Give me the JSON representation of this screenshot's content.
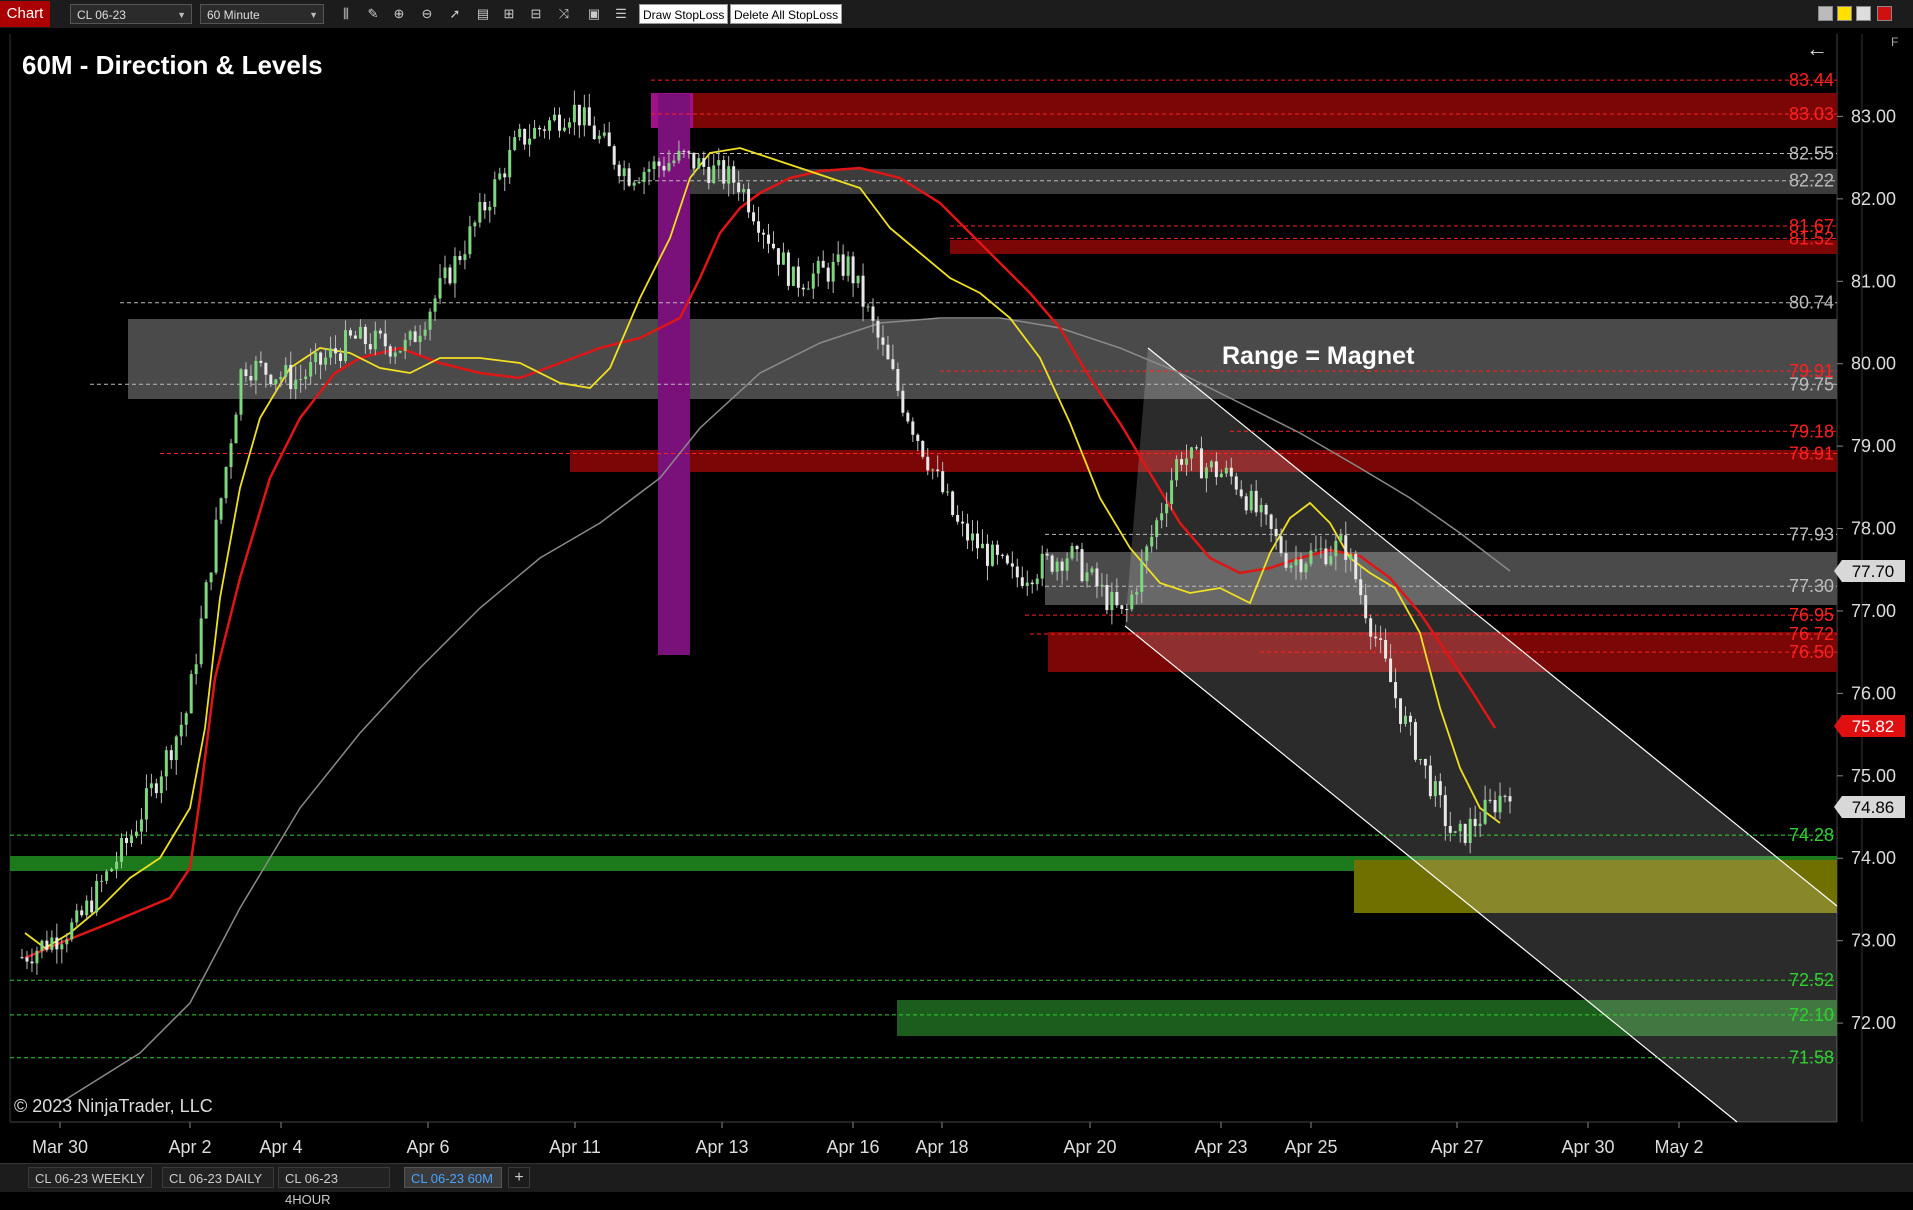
{
  "toolbar": {
    "chart_label": "Chart",
    "instrument": "CL 06-23",
    "interval": "60 Minute",
    "draw_stoploss": "Draw StopLoss",
    "delete_stoploss": "Delete All StopLoss"
  },
  "chart": {
    "title": "60M - Direction & Levels",
    "annotation": "Range = Magnet",
    "copyright": "© 2023 NinjaTrader, LLC",
    "back_arrow": "←",
    "panel_letter": "F",
    "y_axis": {
      "min": 70.8,
      "max": 84.0,
      "ticks": [
        "83.00",
        "82.00",
        "81.00",
        "80.00",
        "79.00",
        "78.00",
        "77.00",
        "76.00",
        "75.00",
        "74.00",
        "73.00",
        "72.00"
      ]
    },
    "x_axis": [
      "Mar 30",
      "Apr 2",
      "Apr 4",
      "Apr 6",
      "Apr 11",
      "Apr 13",
      "Apr 16",
      "Apr 18",
      "Apr 20",
      "Apr 23",
      "Apr 25",
      "Apr 27",
      "Apr 30",
      "May 2"
    ],
    "price_tags": [
      {
        "value": "77.70",
        "color": "#d8d8d8"
      },
      {
        "value": "75.82",
        "color": "#e01010"
      },
      {
        "value": "74.86",
        "color": "#d8d8d8"
      }
    ],
    "levels": [
      {
        "value": "83.44",
        "price": 83.44,
        "color": "#ff2020"
      },
      {
        "value": "83.03",
        "price": 83.03,
        "color": "#ff2020"
      },
      {
        "value": "82.55",
        "price": 82.55,
        "color": "#bbbbbb"
      },
      {
        "value": "82.22",
        "price": 82.22,
        "color": "#bbbbbb"
      },
      {
        "value": "81.67",
        "price": 81.67,
        "color": "#ff2020"
      },
      {
        "value": "81.52",
        "price": 81.52,
        "color": "#ff2020"
      },
      {
        "value": "80.74",
        "price": 80.74,
        "color": "#bbbbbb"
      },
      {
        "value": "79.91",
        "price": 79.91,
        "color": "#ff2020"
      },
      {
        "value": "79.75",
        "price": 79.75,
        "color": "#bbbbbb"
      },
      {
        "value": "79.18",
        "price": 79.18,
        "color": "#ff2020"
      },
      {
        "value": "78.91",
        "price": 78.91,
        "color": "#ff2020"
      },
      {
        "value": "77.93",
        "price": 77.93,
        "color": "#bbbbbb"
      },
      {
        "value": "77.30",
        "price": 77.3,
        "color": "#bbbbbb"
      },
      {
        "value": "76.95",
        "price": 76.95,
        "color": "#ff2020"
      },
      {
        "value": "76.72",
        "price": 76.72,
        "color": "#ff2020"
      },
      {
        "value": "76.50",
        "price": 76.5,
        "color": "#ff2020"
      },
      {
        "value": "74.28",
        "price": 74.28,
        "color": "#30d030"
      },
      {
        "value": "72.52",
        "price": 72.52,
        "color": "#30d030"
      },
      {
        "value": "72.10",
        "price": 72.1,
        "color": "#30d030"
      },
      {
        "value": "71.58",
        "price": 71.58,
        "color": "#30d030"
      }
    ]
  },
  "tabs": [
    "CL 06-23 WEEKLY",
    "CL 06-23 DAILY",
    "CL 06-23 4HOUR",
    "CL 06-23 60M"
  ],
  "add_tab": "+",
  "chart_data": {
    "type": "candlestick",
    "title": "60M - Direction & Levels",
    "x": [
      "Mar 30",
      "Apr 2",
      "Apr 4",
      "Apr 6",
      "Apr 11",
      "Apr 13",
      "Apr 16",
      "Apr 18",
      "Apr 20",
      "Apr 23",
      "Apr 25",
      "Apr 27",
      "Apr 30",
      "May 2"
    ],
    "ylim": [
      70.8,
      84.0
    ],
    "grid": false,
    "series": [
      {
        "name": "",
        "values": [
          72.8,
          73.2,
          74.3,
          75.8,
          80.0,
          79.8,
          80.3,
          80.2,
          81.4,
          82.7,
          83.1,
          82.3,
          82.5,
          82.2,
          81.0,
          81.2,
          79.5,
          78.0,
          77.4,
          77.7,
          76.9,
          78.9,
          78.6,
          77.6,
          77.8,
          75.8,
          74.2,
          74.86
        ]
      }
    ]
  }
}
